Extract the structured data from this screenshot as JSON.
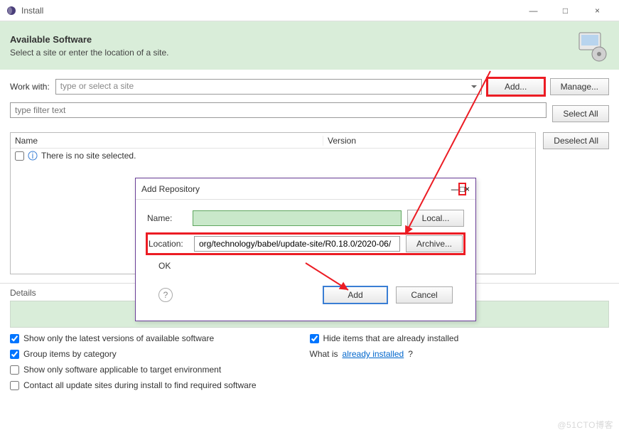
{
  "window": {
    "title": "Install",
    "min": "—",
    "max": "□",
    "close": "×"
  },
  "header": {
    "title": "Available Software",
    "subtitle": "Select a site or enter the location of a site."
  },
  "work": {
    "label": "Work with:",
    "placeholder": "type or select a site",
    "add": "Add...",
    "manage": "Manage..."
  },
  "filter": {
    "placeholder": "type filter text"
  },
  "table": {
    "col1": "Name",
    "col2": "Version",
    "empty": "There is no site selected."
  },
  "side": {
    "selectAll": "Select All",
    "deselectAll": "Deselect All"
  },
  "details": {
    "label": "Details"
  },
  "checks": {
    "showLatest": "Show only the latest versions of available software",
    "group": "Group items by category",
    "applicable": "Show only software applicable to target environment",
    "contact": "Contact all update sites during install to find required software",
    "hide": "Hide items that are already installed",
    "whatIsPre": "What is ",
    "whatIsLink": "already installed",
    "whatIsPost": "?"
  },
  "modal": {
    "title": "Add Repository",
    "nameLabel": "Name:",
    "nameValue": "",
    "local": "Local...",
    "locLabel": "Location:",
    "locValue": "org/technology/babel/update-site/R0.18.0/2020-06/",
    "archive": "Archive...",
    "ok": "OK",
    "add": "Add",
    "cancel": "Cancel",
    "min": "—",
    "max": "□",
    "close": "×",
    "help": "?"
  },
  "watermark": "@51CTO博客"
}
